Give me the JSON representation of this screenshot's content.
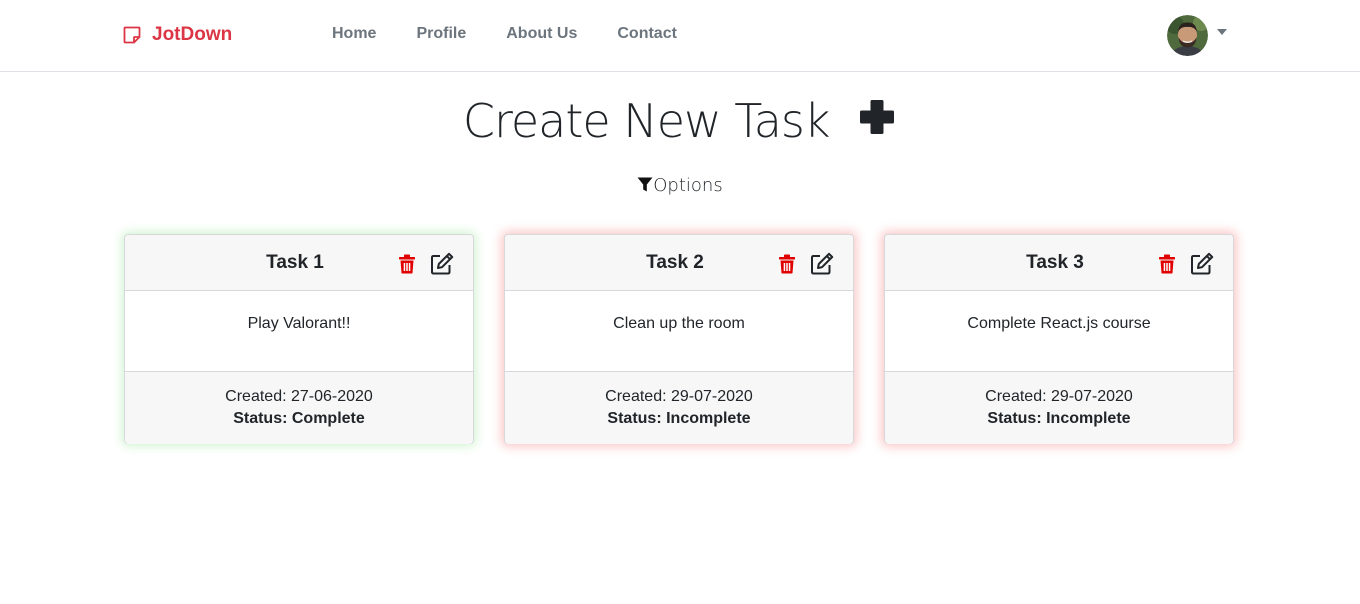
{
  "nav": {
    "brand": "JotDown",
    "links": [
      "Home",
      "Profile",
      "About Us",
      "Contact"
    ]
  },
  "page": {
    "title": "Create New Task",
    "options_label": "Options"
  },
  "tasks": [
    {
      "title": "Task 1",
      "description": "Play Valorant!!",
      "created": "Created: 27-06-2020",
      "status": "Status: Complete"
    },
    {
      "title": "Task 2",
      "description": "Clean up the room",
      "created": "Created: 29-07-2020",
      "status": "Status: Incomplete"
    },
    {
      "title": "Task 3",
      "description": "Complete React.js course",
      "created": "Created: 29-07-2020",
      "status": "Status: Incomplete"
    }
  ],
  "colors": {
    "brand": "#dc3545",
    "trash": "#e00000",
    "complete_glow": "#28c828",
    "incomplete_glow": "#f03c3c"
  },
  "icons": [
    "note-icon",
    "avatar",
    "plus-icon",
    "filter-icon",
    "trash-icon",
    "edit-icon"
  ]
}
